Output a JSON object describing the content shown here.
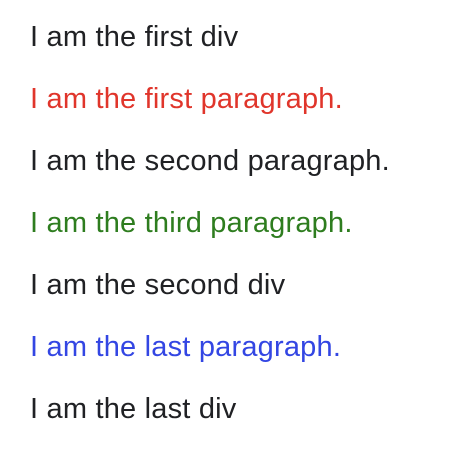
{
  "lines": [
    {
      "text": "I am the first div",
      "color": "#202124"
    },
    {
      "text": "I am the first paragraph.",
      "color": "#e0352b"
    },
    {
      "text": "I am the second paragraph.",
      "color": "#202124"
    },
    {
      "text": "I am the third paragraph.",
      "color": "#2e7d1f"
    },
    {
      "text": "I am the second div",
      "color": "#202124"
    },
    {
      "text": "I am the last paragraph.",
      "color": "#3346e3"
    },
    {
      "text": "I am the last div",
      "color": "#202124"
    }
  ]
}
